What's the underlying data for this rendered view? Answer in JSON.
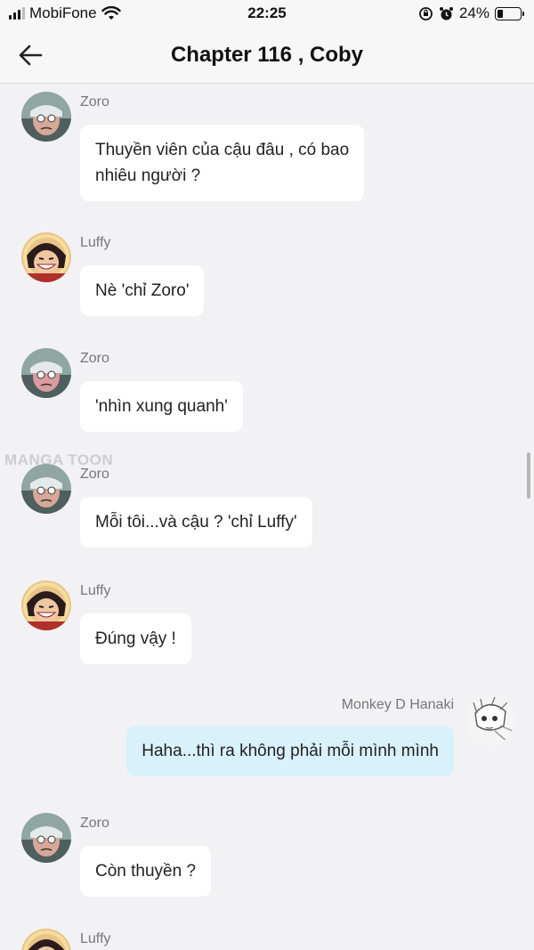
{
  "status_bar": {
    "carrier": "MobiFone",
    "time": "22:25",
    "battery": "24%",
    "icons": [
      "signal-icon",
      "wifi-icon",
      "lock-rotation-icon",
      "alarm-icon",
      "battery-icon"
    ]
  },
  "nav": {
    "back_icon": "arrow-left-icon",
    "title": "Chapter 116 , Coby"
  },
  "watermark": "MANGA TOON",
  "colors": {
    "background": "#f2f2f4",
    "bubble": "#ffffff",
    "own_bubble": "#d9f1fb",
    "name_text": "#777777"
  },
  "messages": [
    {
      "sender": "Zoro",
      "text": "Thuyền viên của cậu đâu , có bao\nnhiêu người ?"
    },
    {
      "sender": "Luffy",
      "text": "Nè 'chỉ Zoro'"
    },
    {
      "sender": "Zoro",
      "text": "'nhìn xung quanh'"
    },
    {
      "sender": "Zoro",
      "text": "Mỗi tôi...và cậu ? 'chỉ Luffy'"
    },
    {
      "sender": "Luffy",
      "text": "Đúng vậy !"
    },
    {
      "sender": "Monkey D Hanaki",
      "text": "Haha...thì ra không phải mỗi mình mình",
      "own": true
    },
    {
      "sender": "Zoro",
      "text": "Còn thuyền ?"
    },
    {
      "sender": "Luffy",
      "text": ""
    }
  ]
}
